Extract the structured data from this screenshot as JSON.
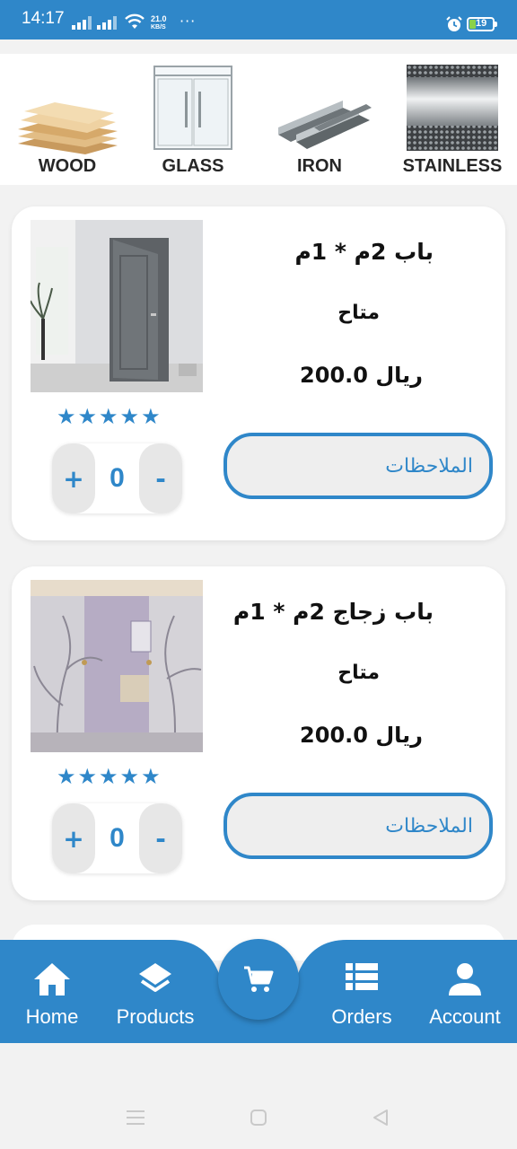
{
  "status_bar": {
    "time": "14:17",
    "net_speed_value": "21.0",
    "net_speed_unit": "KB/S",
    "more": "···",
    "battery": "19"
  },
  "categories": [
    {
      "label": "WOOD",
      "icon": "wood-planks-image"
    },
    {
      "label": "GLASS",
      "icon": "glass-door-image"
    },
    {
      "label": "IRON",
      "icon": "iron-beams-image"
    },
    {
      "label": "STAINLESS",
      "icon": "stainless-steel-image"
    }
  ],
  "products": [
    {
      "name": "باب 2م * 1م",
      "availability": "متاح",
      "price": "200.0 ريال",
      "rating": 5,
      "stars": "★★★★★",
      "quantity": "0",
      "plus": "+",
      "minus": "-",
      "notes_label": "الملاحظات",
      "image": "grey-door-image"
    },
    {
      "name": "باب زجاج 2م * 1م",
      "availability": "متاح",
      "price": "200.0 ريال",
      "rating": 5,
      "stars": "★★★★★",
      "quantity": "0",
      "plus": "+",
      "minus": "-",
      "notes_label": "الملاحظات",
      "image": "frosted-glass-door-image"
    }
  ],
  "bottom_nav": {
    "items": [
      {
        "label": "Home",
        "icon": "home-icon"
      },
      {
        "label": "Products",
        "icon": "layers-icon"
      },
      {
        "label": "Orders",
        "icon": "list-icon"
      },
      {
        "label": "Account",
        "icon": "person-icon"
      }
    ],
    "center_icon": "cart-icon"
  },
  "colors": {
    "accent": "#2f87c9",
    "background": "#f2f2f2",
    "card": "#ffffff"
  }
}
